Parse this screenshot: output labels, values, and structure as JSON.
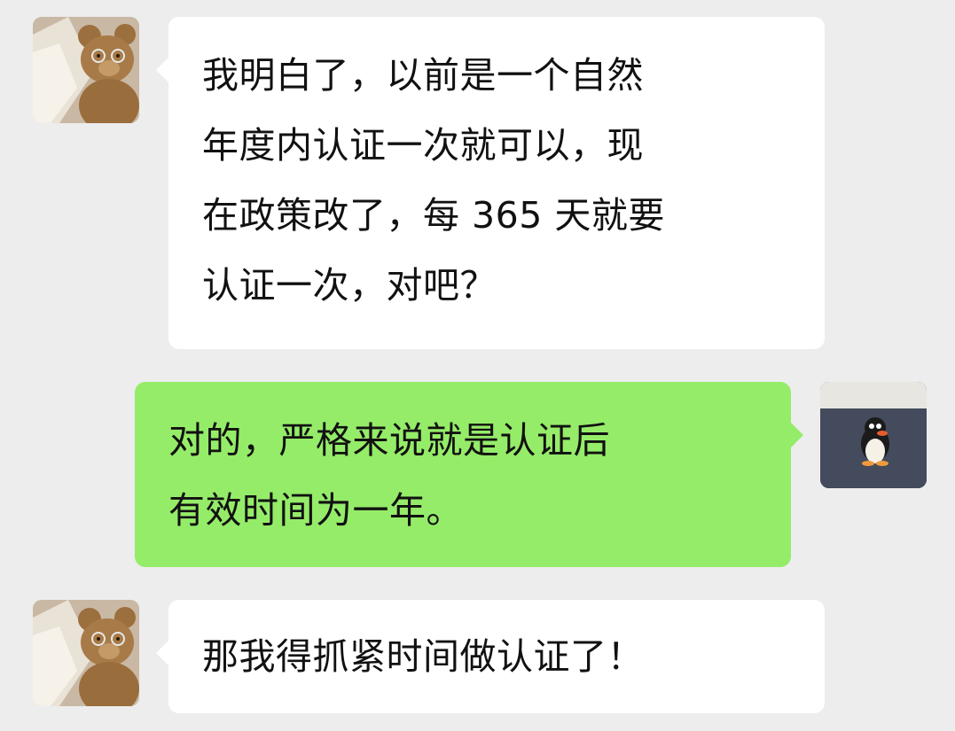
{
  "colors": {
    "background": "#ededed",
    "received_bubble": "#ffffff",
    "sent_bubble": "#95ec69",
    "text": "#111111"
  },
  "messages": [
    {
      "sender": "other",
      "avatar_icon": "teddy-bear-avatar-icon",
      "lines": [
        "我明白了，以前是一个自然",
        "年度内认证一次就可以，现",
        "在政策改了，每 365 天就要",
        "认证一次，对吧？"
      ]
    },
    {
      "sender": "self",
      "avatar_icon": "penguin-avatar-icon",
      "lines": [
        "对的，严格来说就是认证后",
        "有效时间为一年。"
      ]
    },
    {
      "sender": "other",
      "avatar_icon": "teddy-bear-avatar-icon",
      "lines": [
        "那我得抓紧时间做认证了！"
      ]
    }
  ]
}
